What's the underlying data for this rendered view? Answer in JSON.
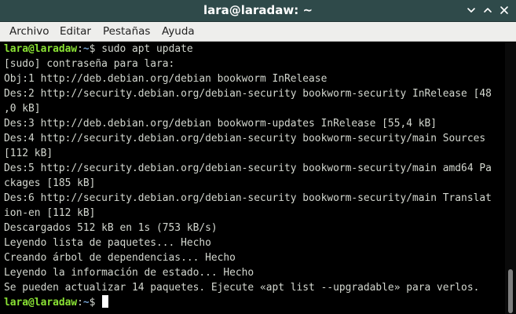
{
  "window": {
    "title": "lara@laradaw: ~",
    "minimize_icon": "chevron-down-icon",
    "maximize_icon": "chevron-up-icon",
    "close_icon": "close-icon"
  },
  "menubar": {
    "items": [
      "Archivo",
      "Editar",
      "Pestañas",
      "Ayuda"
    ]
  },
  "terminal": {
    "colors": {
      "background": "#000000",
      "text": "#d3d7cf",
      "prompt_user": "#8ae234",
      "prompt_path": "#729fcf",
      "cursor": "#ffffff"
    },
    "prompt1": {
      "user": "lara@laradaw",
      "sep": ":",
      "path": "~",
      "symbol": "$",
      "command": " sudo apt update"
    },
    "output": [
      "[sudo] contraseña para lara:",
      "Obj:1 http://deb.debian.org/debian bookworm InRelease",
      "Des:2 http://security.debian.org/debian-security bookworm-security InRelease [48",
      ",0 kB]",
      "Des:3 http://deb.debian.org/debian bookworm-updates InRelease [55,4 kB]",
      "Des:4 http://security.debian.org/debian-security bookworm-security/main Sources",
      "[112 kB]",
      "Des:5 http://security.debian.org/debian-security bookworm-security/main amd64 Pa",
      "ckages [185 kB]",
      "Des:6 http://security.debian.org/debian-security bookworm-security/main Translat",
      "ion-en [112 kB]",
      "Descargados 512 kB en 1s (753 kB/s)",
      "Leyendo lista de paquetes... Hecho",
      "Creando árbol de dependencias... Hecho",
      "Leyendo la información de estado... Hecho",
      "Se pueden actualizar 14 paquetes. Ejecute «apt list --upgradable» para verlos."
    ],
    "prompt2": {
      "user": "lara@laradaw",
      "sep": ":",
      "path": "~",
      "symbol": "$",
      "command": " "
    }
  }
}
